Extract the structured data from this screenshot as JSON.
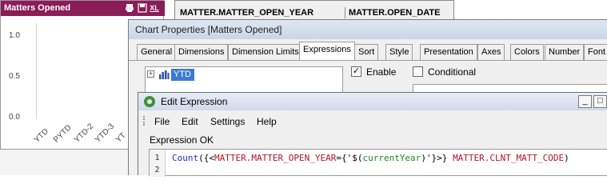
{
  "chart_object": {
    "caption": "Matters Opened",
    "caption_icons": [
      "print-icon",
      "save-icon",
      "xl-icon"
    ],
    "xl_label": "XL",
    "accent_color": "#8a1c58",
    "chart_data": {
      "type": "bar",
      "categories": [
        "YTD",
        "PYTD",
        "YTD-2",
        "YTD-3",
        "YT"
      ],
      "yticks": [
        "1.0",
        "0.5",
        "0.0"
      ],
      "ylim": [
        0,
        1
      ],
      "grid": false
    }
  },
  "table_box": {
    "columns": [
      "MATTER.MATTER_OPEN_YEAR",
      "MATTER.OPEN_DATE"
    ]
  },
  "chart_properties": {
    "title": "Chart Properties [Matters Opened]",
    "tabs": [
      "General",
      "Dimensions",
      "Dimension Limits",
      "Expressions",
      "Sort",
      "Style",
      "Presentation",
      "Axes",
      "Colors",
      "Number",
      "Font"
    ],
    "active_tab": "Expressions",
    "expression_tree": {
      "expand_glyph": "+",
      "items": [
        {
          "label": "YTD"
        }
      ]
    },
    "enable_label": "Enable",
    "enable_checked": true,
    "conditional_label": "Conditional",
    "conditional_checked": false
  },
  "edit_expression": {
    "title": "Edit Expression",
    "window_buttons": [
      "_",
      "□"
    ],
    "menu": [
      "File",
      "Edit",
      "Settings",
      "Help"
    ],
    "status": "Expression OK",
    "line_numbers": [
      "1",
      "2"
    ],
    "code": {
      "fn": "Count",
      "open": "({<",
      "field1": "MATTER.MATTER_OPEN_YEAR",
      "eq": "={'",
      "dollar_open": "$(",
      "var": "currentYear",
      "dollar_close": ")",
      "close_set": "'}>}",
      "field2": "MATTER.CLNT_MATT_CODE",
      "end": ")"
    }
  }
}
